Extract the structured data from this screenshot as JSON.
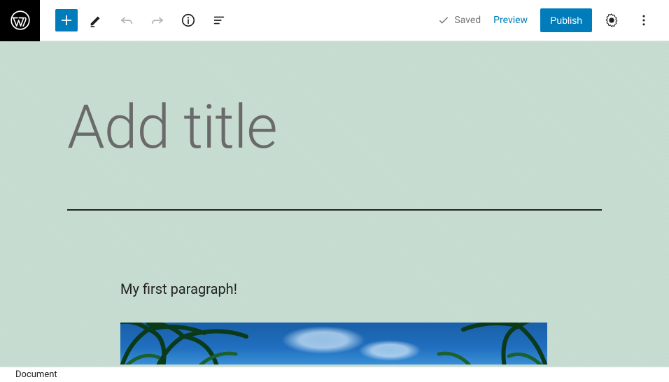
{
  "toolbar": {
    "saved_label": "Saved",
    "preview_label": "Preview",
    "publish_label": "Publish"
  },
  "editor": {
    "title_placeholder": "Add title",
    "paragraph_text": "My first paragraph!"
  },
  "footer": {
    "breadcrumb": "Document"
  }
}
